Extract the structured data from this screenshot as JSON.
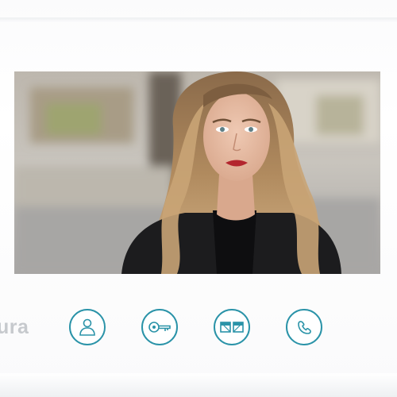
{
  "brand": {
    "text": "ura"
  },
  "screen": {
    "content": "camera-feed"
  },
  "buttons": [
    {
      "icon": "person-icon"
    },
    {
      "icon": "key-icon"
    },
    {
      "icon": "gate-icon"
    },
    {
      "icon": "phone-icon"
    }
  ],
  "colors": {
    "accent": "#2a93a8",
    "device": "#ffffff",
    "brand_text": "#c6c9cd"
  }
}
